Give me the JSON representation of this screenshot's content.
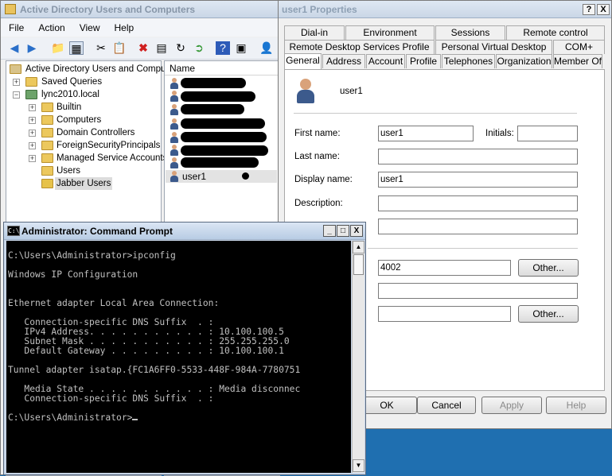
{
  "aduc": {
    "title": "Active Directory Users and Computers",
    "menu": [
      "File",
      "Action",
      "View",
      "Help"
    ],
    "tree": {
      "root": "Active Directory Users and Comput",
      "saved_queries": "Saved Queries",
      "domain": "lync2010.local",
      "children": [
        "Builtin",
        "Computers",
        "Domain Controllers",
        "ForeignSecurityPrincipals",
        "Managed Service Accounts",
        "Users",
        "Jabber Users"
      ]
    },
    "list": {
      "column": "Name",
      "selected_user": "user1"
    }
  },
  "props": {
    "title": "user1 Properties",
    "help_btn": "?",
    "close_btn": "X",
    "tabs_row1": [
      "Dial-in",
      "Environment",
      "Sessions",
      "Remote control"
    ],
    "tabs_row2": [
      "Remote Desktop Services Profile",
      "Personal Virtual Desktop",
      "COM+"
    ],
    "tabs_row3": [
      "General",
      "Address",
      "Account",
      "Profile",
      "Telephones",
      "Organization",
      "Member Of"
    ],
    "username": "user1",
    "labels": {
      "first_name": "First name:",
      "initials": "Initials:",
      "last_name": "Last name:",
      "display_name": "Display name:",
      "description": "Description:"
    },
    "values": {
      "first_name": "user1",
      "initials": "",
      "last_name": "",
      "display_name": "user1",
      "description": "",
      "office": "",
      "telephone": "4002",
      "email": "",
      "webpage": ""
    },
    "other_btn": "Other...",
    "buttons": {
      "ok": "OK",
      "cancel": "Cancel",
      "apply": "Apply",
      "help": "Help"
    }
  },
  "cmd": {
    "title": "Administrator: Command Prompt",
    "icon_text": "C:\\",
    "lines": [
      "C:\\Users\\Administrator>ipconfig",
      "",
      "Windows IP Configuration",
      "",
      "",
      "Ethernet adapter Local Area Connection:",
      "",
      "   Connection-specific DNS Suffix  . :",
      "   IPv4 Address. . . . . . . . . . . : 10.100.100.5",
      "   Subnet Mask . . . . . . . . . . . : 255.255.255.0",
      "   Default Gateway . . . . . . . . . : 10.100.100.1",
      "",
      "Tunnel adapter isatap.{FC1A6FF0-5533-448F-984A-7780751",
      "",
      "   Media State . . . . . . . . . . . : Media disconnec",
      "   Connection-specific DNS Suffix  . :",
      "",
      "C:\\Users\\Administrator>"
    ],
    "window_buttons": [
      "_",
      "□",
      "X"
    ]
  }
}
